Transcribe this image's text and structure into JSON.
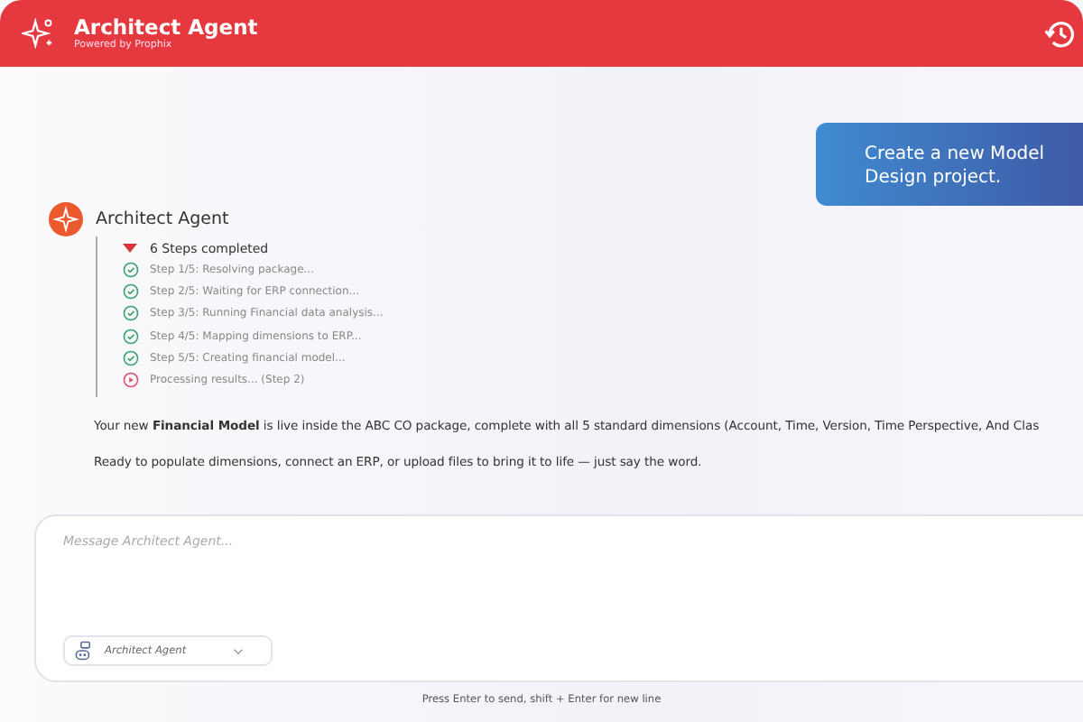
{
  "header": {
    "title": "Architect Agent",
    "subtitle": "Powered by Prophix"
  },
  "user_message": "Create a new Model Design project.",
  "agent": {
    "name": "Architect Agent",
    "summary": "6 Steps completed",
    "expanded": true,
    "steps": [
      {
        "text": "Step 1/5: Resolving package...",
        "kind": "done"
      },
      {
        "text": "Step 2/5: Waiting for ERP connection...",
        "kind": "done"
      },
      {
        "text": "Step 3/5: Running Financial data analysis...",
        "kind": "done"
      },
      {
        "text": "Step 4/5: Mapping dimensions to ERP...",
        "kind": "done"
      },
      {
        "text": "Step 5/5: Creating financial model...",
        "kind": "done"
      },
      {
        "text": "Processing results... (Step 2)",
        "kind": "running"
      }
    ],
    "paragraphs": [
      "Your new **Financial Model** is live inside the ABC CO package, complete with all 5 standard dimensions (Account, Time, Version, Time Perspective, And Clas",
      "Ready to populate dimensions, connect an ERP, or upload files to bring it to life — just say the word."
    ]
  },
  "composer": {
    "placeholder": "Message Architect Agent...",
    "agent_select": "Architect Agent",
    "hint": "Press Enter to send, shift + Enter for new line"
  }
}
